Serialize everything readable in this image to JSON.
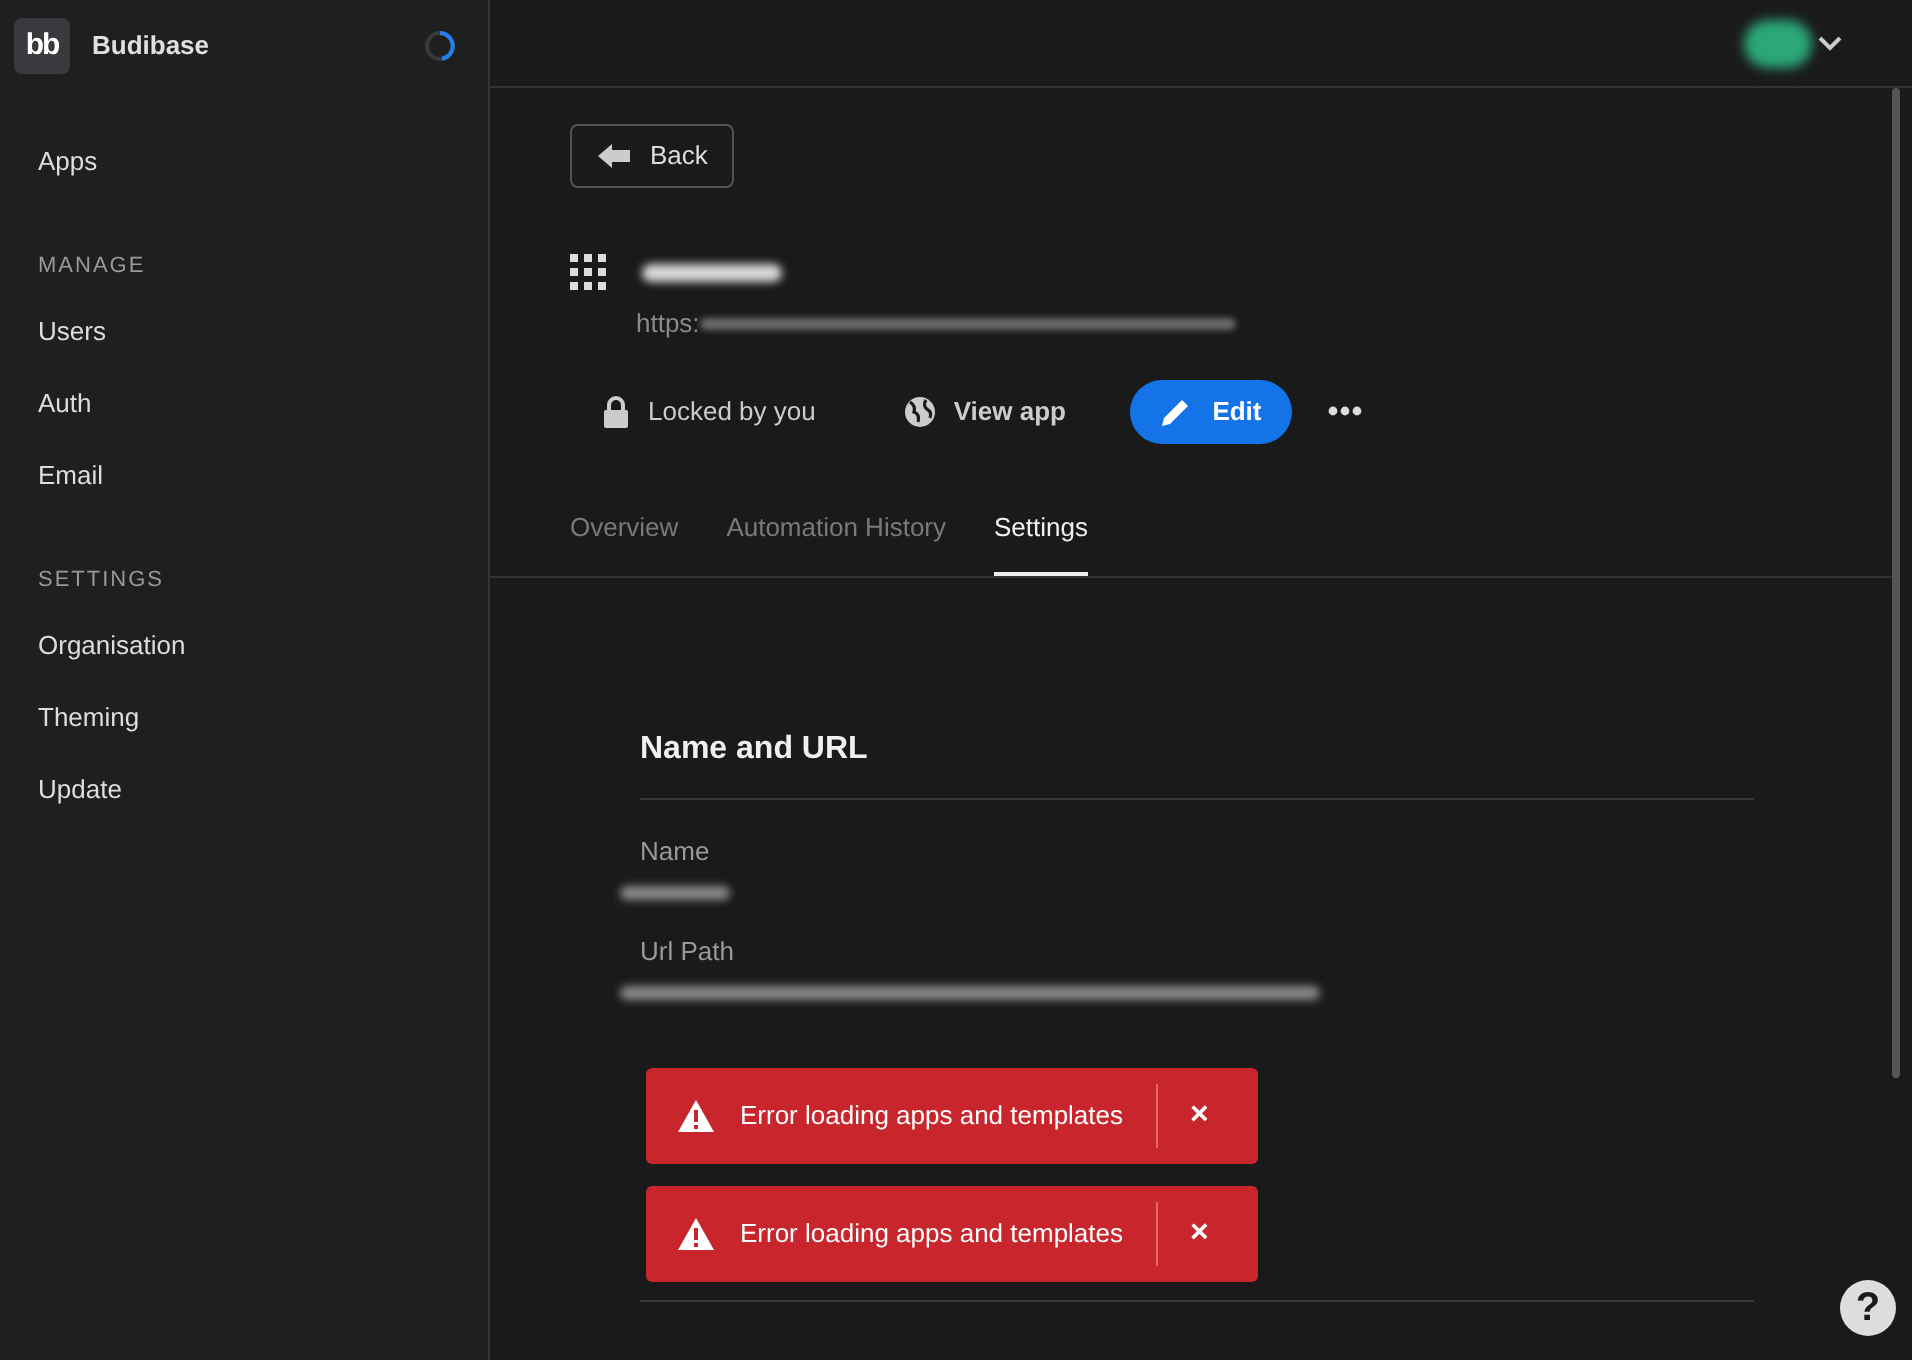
{
  "sidebar": {
    "logo": "bb",
    "brand": "Budibase",
    "loading": true,
    "items": [
      {
        "kind": "item",
        "label": "Apps"
      },
      {
        "kind": "heading",
        "label": "MANAGE"
      },
      {
        "kind": "item",
        "label": "Users"
      },
      {
        "kind": "item",
        "label": "Auth"
      },
      {
        "kind": "item",
        "label": "Email"
      },
      {
        "kind": "heading",
        "label": "SETTINGS"
      },
      {
        "kind": "item",
        "label": "Organisation"
      },
      {
        "kind": "item",
        "label": "Theming"
      },
      {
        "kind": "item",
        "label": "Update"
      }
    ]
  },
  "back_button": "Back",
  "app": {
    "url_prefix": "https:"
  },
  "actions": {
    "lock": "Locked by you",
    "view": "View app",
    "edit": "Edit"
  },
  "tabs": [
    {
      "label": "Overview",
      "selected": false
    },
    {
      "label": "Automation History",
      "selected": false
    },
    {
      "label": "Settings",
      "selected": true
    }
  ],
  "section": {
    "title": "Name and URL",
    "fields": [
      {
        "label": "Name"
      },
      {
        "label": "Url Path"
      }
    ]
  },
  "toasts": [
    {
      "message": "Error loading apps and templates",
      "close": "×"
    },
    {
      "message": "Error loading apps and templates",
      "close": "×"
    }
  ],
  "help": "?"
}
